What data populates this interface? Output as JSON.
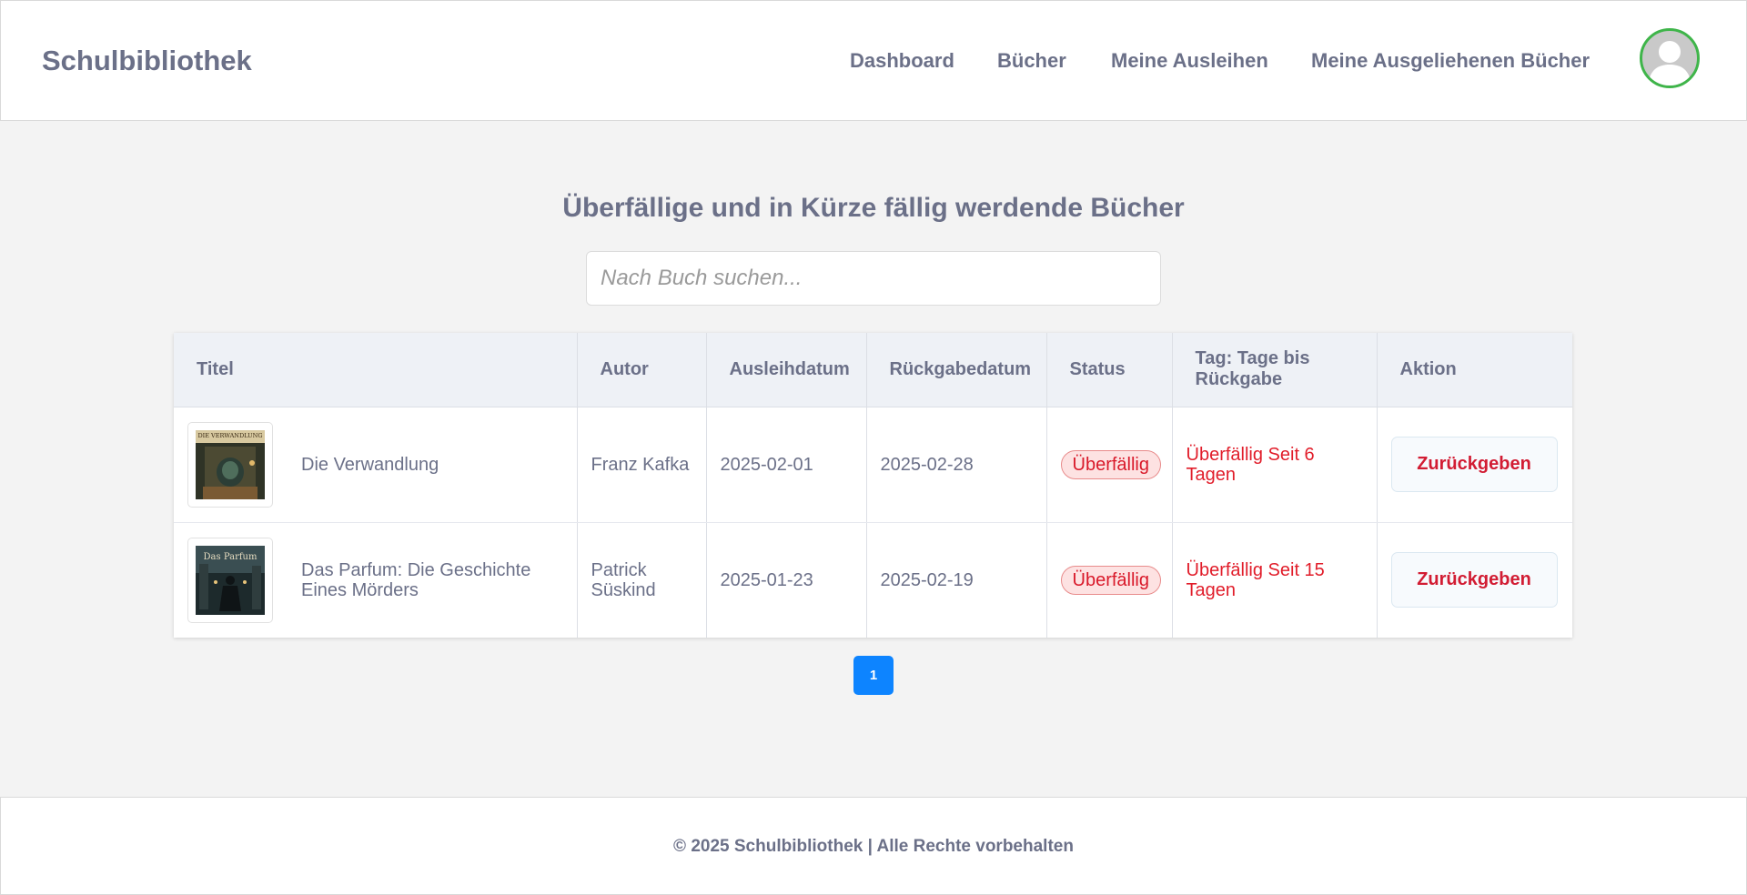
{
  "header": {
    "brand": "Schulbibliothek",
    "nav": [
      "Dashboard",
      "Bücher",
      "Meine Ausleihen",
      "Meine Ausgeliehenen Bücher"
    ]
  },
  "main": {
    "title": "Überfällige und in Kürze fällig werdende Bücher",
    "search_placeholder": "Nach Buch suchen...",
    "table": {
      "columns": [
        "Titel",
        "Autor",
        "Ausleihdatum",
        "Rückgabedatum",
        "Status",
        "Tag: Tage bis Rückgabe",
        "Aktion"
      ],
      "rows": [
        {
          "title": "Die Verwandlung",
          "author": "Franz Kafka",
          "loan_date": "2025-02-01",
          "return_date": "2025-02-28",
          "status": "Überfällig",
          "days": "Überfällig Seit 6 Tagen",
          "action": "Zurückgeben",
          "cover_text": "DIE VERWANDLUNG"
        },
        {
          "title": "Das Parfum: Die Geschichte Eines Mörders",
          "author": "Patrick Süskind",
          "loan_date": "2025-01-23",
          "return_date": "2025-02-19",
          "status": "Überfällig",
          "days": "Überfällig Seit 15 Tagen",
          "action": "Zurückgeben",
          "cover_text": "Das Parfum"
        }
      ]
    },
    "pagination": {
      "current": "1"
    }
  },
  "footer": {
    "text": "© 2025 Schulbibliothek | Alle Rechte vorbehalten"
  },
  "colors": {
    "accent": "#0d84ff",
    "status_overdue": "#e11d2a",
    "avatar_ring": "#3fb54a"
  }
}
